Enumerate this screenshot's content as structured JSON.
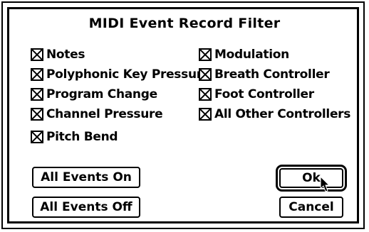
{
  "dialog": {
    "title": "MIDI Event Record Filter",
    "left_column": [
      {
        "label": "Notes",
        "checked": true
      },
      {
        "label": "Polyphonic Key Pressure",
        "checked": true
      },
      {
        "label": "Program Change",
        "checked": true
      },
      {
        "label": "Channel Pressure",
        "checked": true
      },
      {
        "label": "Pitch Bend",
        "checked": true
      }
    ],
    "right_column": [
      {
        "label": "Modulation",
        "checked": true
      },
      {
        "label": "Breath Controller",
        "checked": true
      },
      {
        "label": "Foot Controller",
        "checked": true
      },
      {
        "label": "All Other Controllers",
        "checked": true
      }
    ],
    "buttons": {
      "all_on": "All Events On",
      "all_off": "All Events Off",
      "ok": "Ok",
      "cancel": "Cancel"
    }
  }
}
